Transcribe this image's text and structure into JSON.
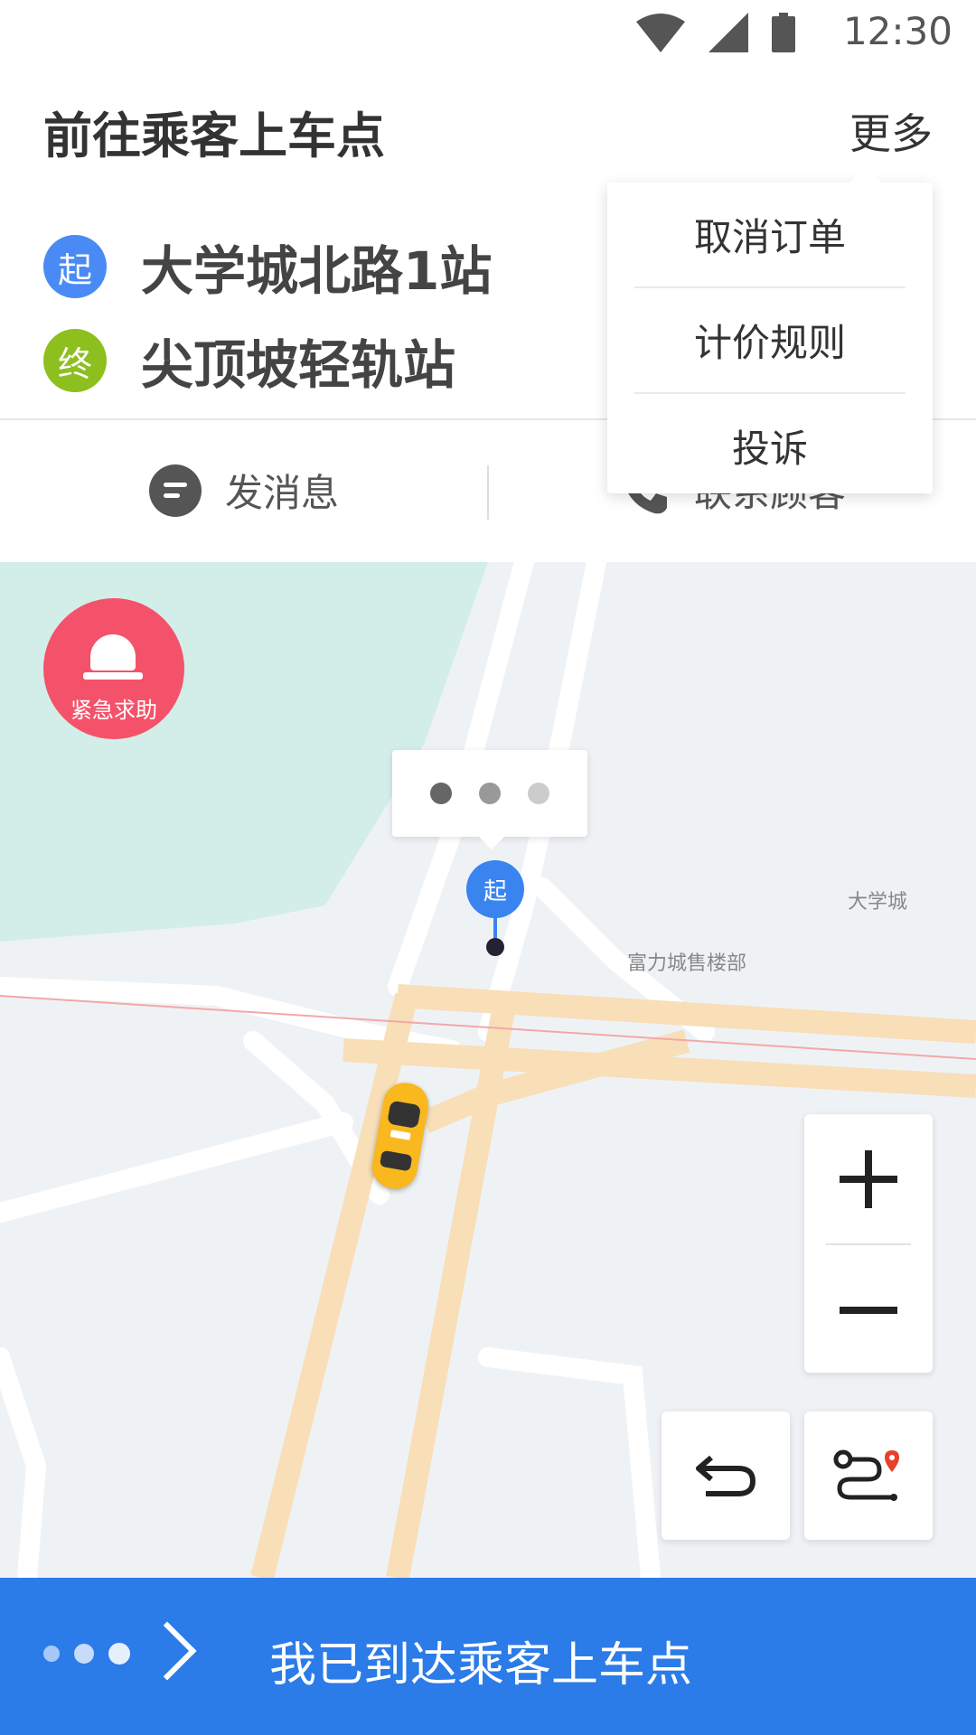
{
  "status_bar": {
    "time": "12:30"
  },
  "header": {
    "title": "前往乘客上车点",
    "more_label": "更多"
  },
  "route": {
    "start_badge": "起",
    "start_place": "大学城北路1站",
    "end_badge": "终",
    "end_place": "尖顶坡轻轨站"
  },
  "actions": {
    "message_label": "发消息",
    "call_label": "联系顾客"
  },
  "menu": {
    "items": [
      "取消订单",
      "计价规则",
      "投诉"
    ]
  },
  "map": {
    "sos_label": "紧急求助",
    "start_pin_label": "起",
    "place_labels": [
      "大学城",
      "富力城售楼部"
    ]
  },
  "bottom_bar": {
    "label": "我已到达乘客上车点"
  },
  "colors": {
    "accent": "#2b7be8",
    "start": "#4a8af4",
    "end": "#8dbf1f",
    "sos": "#f4526a",
    "car": "#f8b81e"
  }
}
